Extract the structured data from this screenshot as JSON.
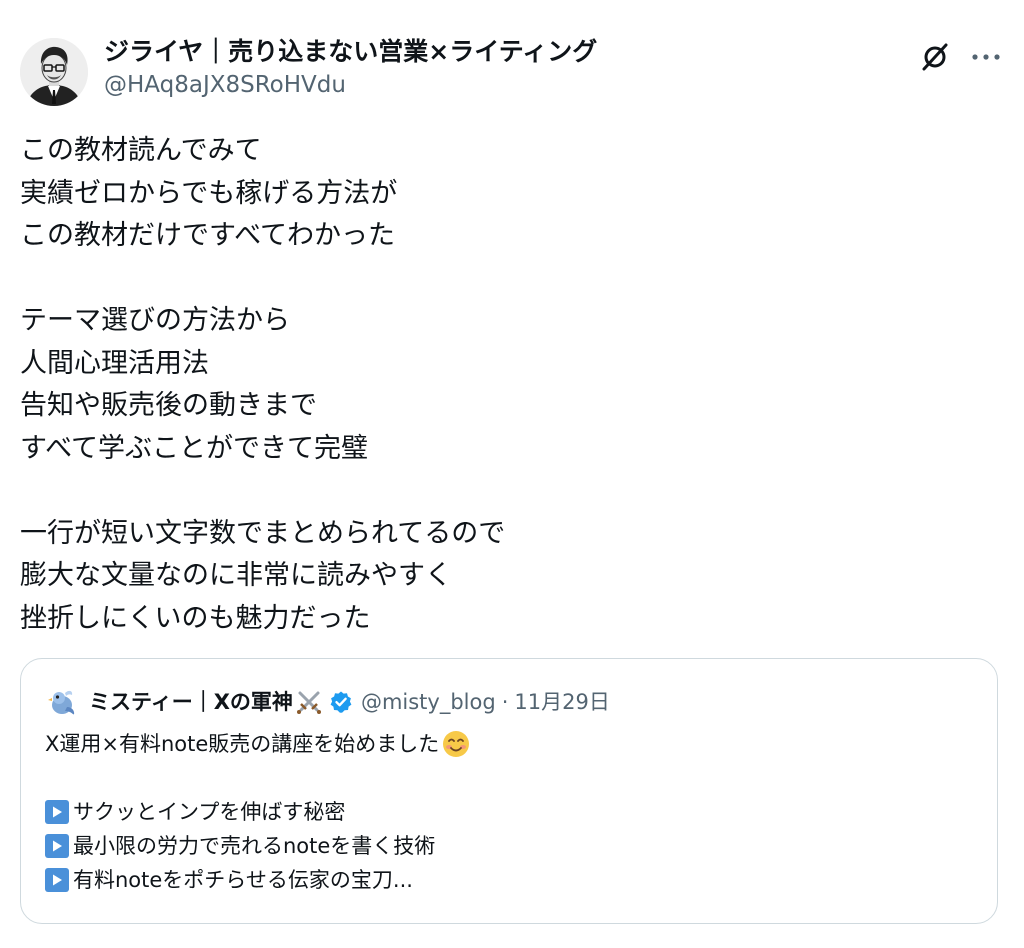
{
  "author": {
    "display_name": "ジライヤ｜売り込まない営業×ライティング",
    "handle": "@HAq8aJX8SRoHVdu"
  },
  "actions": {
    "grok_icon": "grok-icon",
    "more_icon": "more-horizontal-icon"
  },
  "body": {
    "lines": [
      "この教材読んでみて",
      "実績ゼロからでも稼げる方法が",
      "この教材だけですべてわかった",
      "",
      "テーマ選びの方法から",
      "人間心理活用法",
      "告知や販売後の動きまで",
      "すべて学ぶことができて完璧",
      "",
      "一行が短い文字数でまとめられてるので",
      "膨大な文量なのに非常に読みやすく",
      "挫折しにくいのも魅力だった"
    ]
  },
  "quote": {
    "display_name": "ミスティー｜Xの軍神",
    "handle": "@misty_blog",
    "separator": "·",
    "date": "11月29日",
    "verified": true,
    "lines": [
      "X運用×有料note販売の講座を始めました",
      "",
      "サクッとインプを伸ばす秘密",
      "最小限の労力で売れるnoteを書く技術",
      "有料noteをポチらせる伝家の宝刀..."
    ]
  },
  "colors": {
    "text": "#0f1419",
    "secondary": "#536471",
    "border": "#cfd9de",
    "verified": "#1d9bf0",
    "play_button": "#4a90d9"
  }
}
